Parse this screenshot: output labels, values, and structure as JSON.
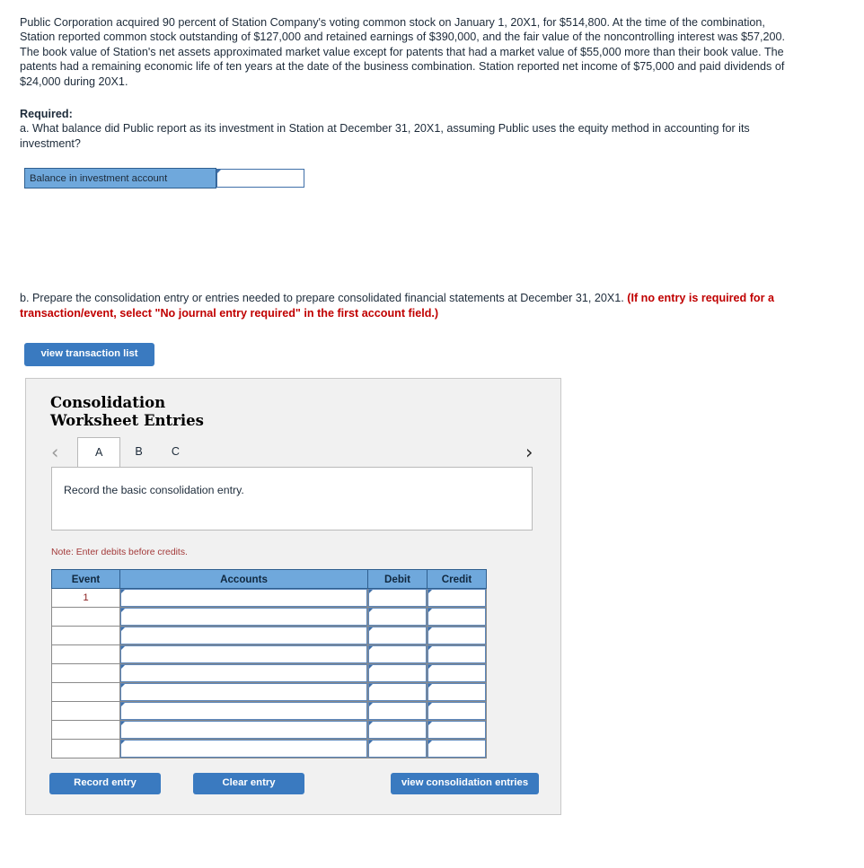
{
  "problem": {
    "text": "Public Corporation acquired 90 percent of Station Company's voting common stock on January 1, 20X1, for $514,800. At the time of the combination, Station reported common stock outstanding of $127,000 and retained earnings of $390,000, and the fair value of the noncontrolling interest was $57,200. The book value of Station's net assets approximated market value except for patents that had a market value of $55,000 more than their book value. The patents had a remaining economic life of ten years at the date of the business combination. Station reported net income of $75,000 and paid dividends of $24,000 during 20X1."
  },
  "required": {
    "heading": "Required:",
    "question_a": "a. What balance did Public report as its investment in Station at December 31, 20X1, assuming Public uses the equity method in accounting for its investment?"
  },
  "answer_table": {
    "label": "Balance in investment account",
    "value": "",
    "placeholder": ""
  },
  "part_b": {
    "normal_text": "b. Prepare the consolidation entry or entries needed to prepare consolidated financial statements at December 31, 20X1. ",
    "bold_red_text": "(If no entry is required for a transaction/event, select \"No journal entry required\" in the first account field.)"
  },
  "buttons": {
    "view_transaction_list": "view transaction list",
    "record_entry": "Record entry",
    "clear_entry": "Clear entry",
    "view_consolidation_entries": "view consolidation entries"
  },
  "panel": {
    "title": "Consolidation\nWorksheet Entries",
    "prev_arrow": "‹",
    "next_arrow": "›",
    "tabs": [
      {
        "label": "A",
        "active": true
      },
      {
        "label": "B",
        "active": false
      },
      {
        "label": "C",
        "active": false
      }
    ],
    "instruction": "Record the basic consolidation entry.",
    "note": "Note: Enter debits before credits."
  },
  "journal_table": {
    "columns": [
      "Event",
      "Accounts",
      "Debit",
      "Credit"
    ],
    "rows": [
      {
        "event": "1",
        "accounts": "",
        "debit": "",
        "credit": ""
      },
      {
        "event": "",
        "accounts": "",
        "debit": "",
        "credit": ""
      },
      {
        "event": "",
        "accounts": "",
        "debit": "",
        "credit": ""
      },
      {
        "event": "",
        "accounts": "",
        "debit": "",
        "credit": ""
      },
      {
        "event": "",
        "accounts": "",
        "debit": "",
        "credit": ""
      },
      {
        "event": "",
        "accounts": "",
        "debit": "",
        "credit": ""
      },
      {
        "event": "",
        "accounts": "",
        "debit": "",
        "credit": ""
      },
      {
        "event": "",
        "accounts": "",
        "debit": "",
        "credit": ""
      },
      {
        "event": "",
        "accounts": "",
        "debit": "",
        "credit": ""
      }
    ]
  },
  "colors": {
    "accent_blue": "#3a7ac0",
    "header_blue": "#6fa8dc",
    "red_warning": "#c00000",
    "note_red": "#a33a3a",
    "panel_bg": "#f1f1f1"
  }
}
